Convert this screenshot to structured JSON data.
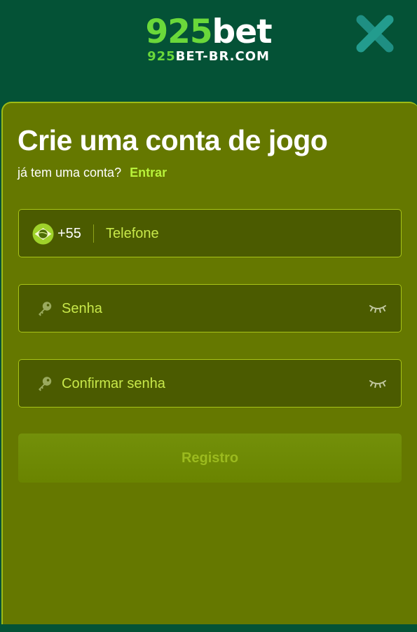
{
  "header": {
    "logo_number": "925",
    "logo_word": "bet",
    "logo_domain_number": "925",
    "logo_domain_word": "BET-BR.COM",
    "close_icon": "close-x-icon"
  },
  "form": {
    "title": "Crie uma conta de jogo",
    "subtitle": "já tem uma conta?",
    "login_link": "Entrar",
    "phone": {
      "flag_icon": "brazil-flag-icon",
      "country_code": "+55",
      "placeholder": "Telefone"
    },
    "password": {
      "icon": "key-icon",
      "placeholder": "Senha",
      "toggle_icon": "eye-closed-icon"
    },
    "confirm_password": {
      "icon": "key-icon",
      "placeholder": "Confirmar senha",
      "toggle_icon": "eye-closed-icon"
    },
    "submit_label": "Registro"
  },
  "colors": {
    "header_bg": "#045236",
    "panel_bg": "#657800",
    "field_bg": "#4b5b00",
    "field_border": "#a8c417",
    "accent_green": "#6ad83a",
    "link_color": "#b8f23a",
    "placeholder_color": "#c8e84a"
  }
}
